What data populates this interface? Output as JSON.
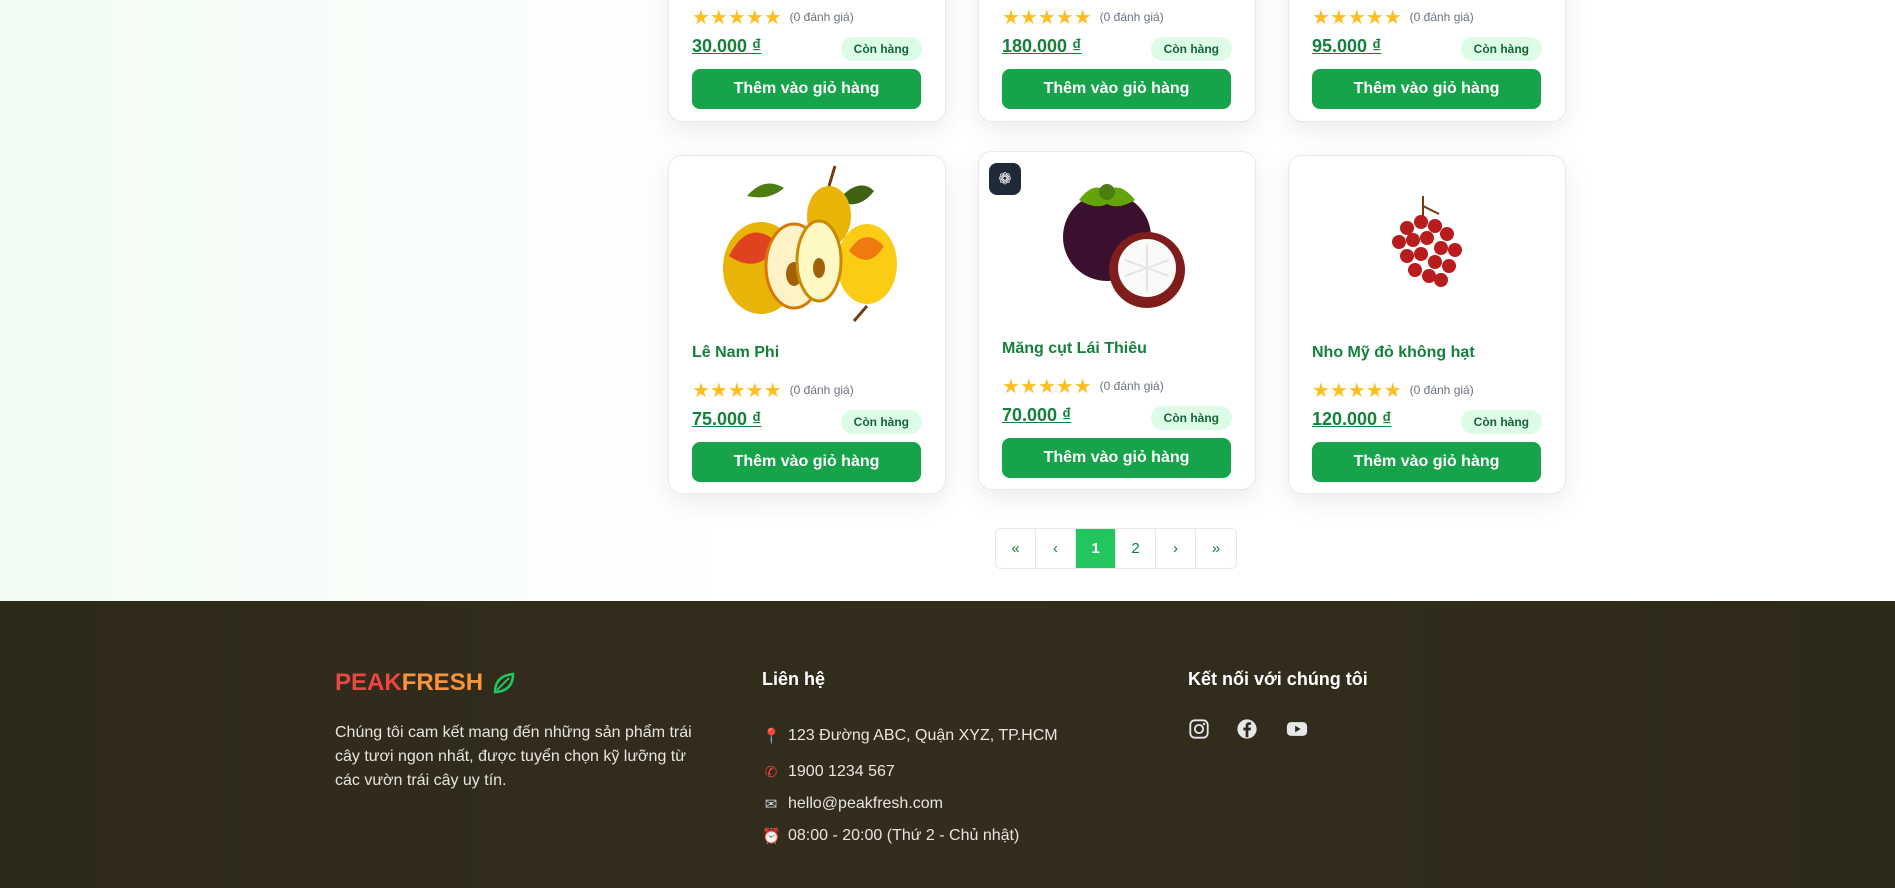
{
  "products": [
    {
      "name": "",
      "rating_text": "(0 đánh giá)",
      "price": "30.000 ₫",
      "stock": "Còn hàng",
      "button": "Thêm vào giỏ hàng"
    },
    {
      "name": "",
      "rating_text": "(0 đánh giá)",
      "price": "180.000 ₫",
      "stock": "Còn hàng",
      "button": "Thêm vào giỏ hàng"
    },
    {
      "name": "",
      "rating_text": "(0 đánh giá)",
      "price": "95.000 ₫",
      "stock": "Còn hàng",
      "button": "Thêm vào giỏ hàng"
    },
    {
      "name": "Lê Nam Phi",
      "rating_text": "(0 đánh giá)",
      "price": "75.000 ₫",
      "stock": "Còn hàng",
      "button": "Thêm vào giỏ hàng",
      "image_icon": "pear-image"
    },
    {
      "name": "Măng cụt Lái Thiêu",
      "rating_text": "(0 đánh giá)",
      "price": "70.000 ₫",
      "stock": "Còn hàng",
      "button": "Thêm vào giỏ hàng",
      "image_icon": "mangosteen-image",
      "badge_icon": "brain-icon"
    },
    {
      "name": "Nho Mỹ đỏ không hạt",
      "rating_text": "(0 đánh giá)",
      "price": "120.000 ₫",
      "stock": "Còn hàng",
      "button": "Thêm vào giỏ hàng",
      "image_icon": "red-grape-image"
    }
  ],
  "stars": "★★★★★",
  "rating_value": 5,
  "pagination": {
    "first": "«",
    "prev": "‹",
    "pages": [
      "1",
      "2"
    ],
    "current": "1",
    "next": "›",
    "last": "»"
  },
  "footer": {
    "brand_peak": "PEAK",
    "brand_fresh": "FRESH",
    "brand_icon": "leaf-icon",
    "description": "Chúng tôi cam kết mang đến những sản phẩm trái cây tươi ngon nhất, được tuyển chọn kỹ lưỡng từ các vườn trái cây uy tín.",
    "contact_title": "Liên hệ",
    "address": "123 Đường ABC, Quận XYZ, TP.HCM",
    "phone": "1900 1234 567",
    "email": "hello@peakfresh.com",
    "hours": "08:00 - 20:00 (Thứ 2 - Chủ nhật)",
    "social_title": "Kết nối với chúng tôi",
    "socials": [
      "instagram-icon",
      "facebook-icon",
      "youtube-icon"
    ]
  },
  "colors": {
    "primary": "#16a34a",
    "price": "#15803d",
    "stock_bg": "#dcfce7",
    "footer_bg": "#2f2a1a",
    "brand_peak": "#ef4444",
    "brand_fresh": "#fb923c",
    "star": "#fbbf24"
  }
}
